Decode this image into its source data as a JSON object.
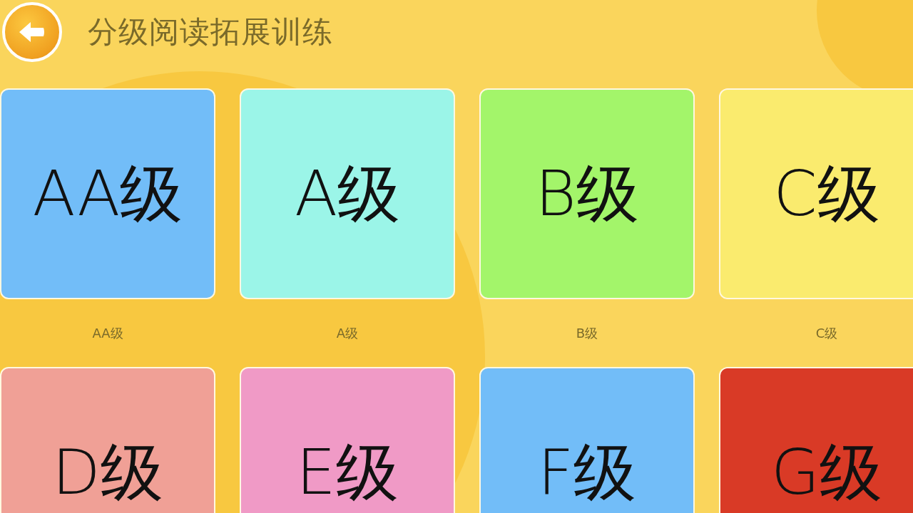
{
  "header": {
    "title": "分级阅读拓展训练"
  },
  "levels": [
    {
      "card_text": "AA级",
      "label": "AA级",
      "color": "#72bdf8"
    },
    {
      "card_text": "A级",
      "label": "A级",
      "color": "#9bf5e8"
    },
    {
      "card_text": "B级",
      "label": "B级",
      "color": "#a3f56a"
    },
    {
      "card_text": "C级",
      "label": "C级",
      "color": "#faeb6e"
    },
    {
      "card_text": "D级",
      "color": "#f0a096"
    },
    {
      "card_text": "E级",
      "color": "#f09ac6"
    },
    {
      "card_text": "F级",
      "color": "#72bdf8"
    },
    {
      "card_text": "G级",
      "color": "#d93a26"
    }
  ]
}
